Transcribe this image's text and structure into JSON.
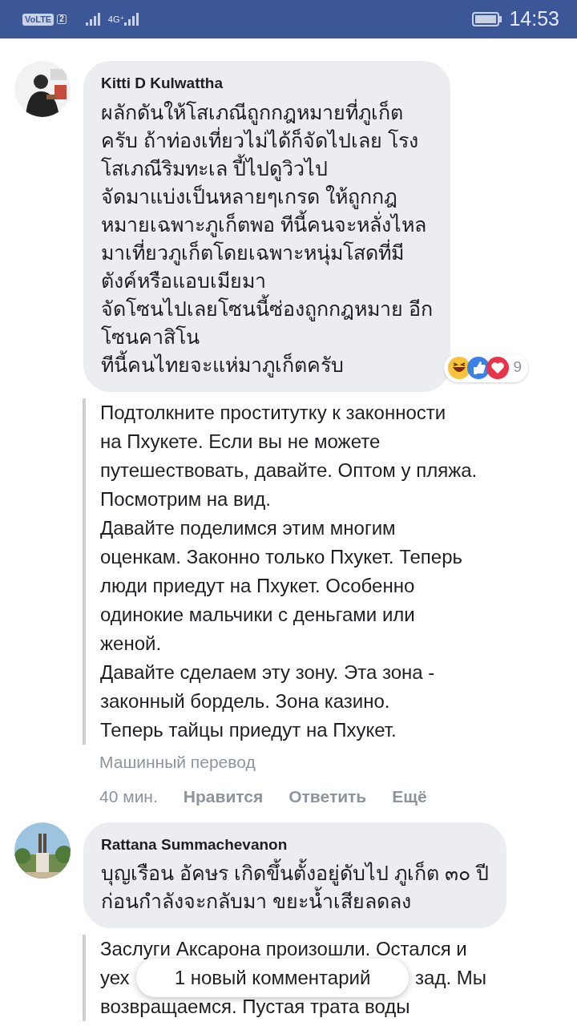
{
  "status_bar": {
    "volte": "VoLTE",
    "sim": "2",
    "network": "4G⁺",
    "time": "14:53"
  },
  "comments": [
    {
      "author": "Kitti D Kulwattha",
      "text": "ผลักดันให้โสเภณีถูกกฎหมายที่ภูเก็ต\nครับ ถ้าท่องเที่ยวไม่ได้ก็จัดไปเลย โรง\nโสเภณีริมทะเล ปี้ไปดูวิวไป\nจัดมาแบ่งเป็นหลายๆเกรด ให้ถูกกฎ\nหมายเฉพาะภูเก็ตพอ ทีนี้คนจะหลั่งไหล\nมาเที่ยวภูเก็ตโดยเฉพาะหนุ่มโสดที่มี\nตังค์หรือแอบเมียมา\nจัดโซนไปเลยโซนนี้ซ่องถูกกฎหมาย อีก\nโซนคาสิโน\nทีนี้คนไทยจะแห่มาภูเก็ตครับ",
      "reactions": {
        "count": "9"
      },
      "translation_lines": [
        "Подтолкните проститутку к законности\nна Пхукете. Если вы не можете\nпутешествовать, давайте. Оптом у пляжа.\nПосмотрим на вид.\nДавайте поделимся этим многим\nоценкам. Законно только Пхукет. Теперь\nлюди приедут на Пхукет. Особенно\nодинокие мальчики с деньгами или\nженой.\nДавайте сделаем эту зону. Эта зона -\nзаконный бордель. Зона казино.\nТеперь тайцы приедут на Пхукет."
      ],
      "translation_note": "Машинный перевод",
      "time": "40 мин.",
      "actions": [
        "Нравится",
        "Ответить",
        "Ещё"
      ]
    },
    {
      "author": "Rattana Summachevanon",
      "text": "บุญเรือน อัคษร เกิดขึ้นตั้งอยู่ดับไป ภูเก็ต ๓๐ ปี\nก่อนกำลังจะกลับมา ขยะน้ำเสียลดลง",
      "translation_lines": [
        "Заслуги Аксарона произошли. Остался и",
        [
          "уех",
          "зад. Мы"
        ],
        "возвращаемся. Пустая трата воды"
      ]
    }
  ],
  "toast": "1 новый комментарий"
}
